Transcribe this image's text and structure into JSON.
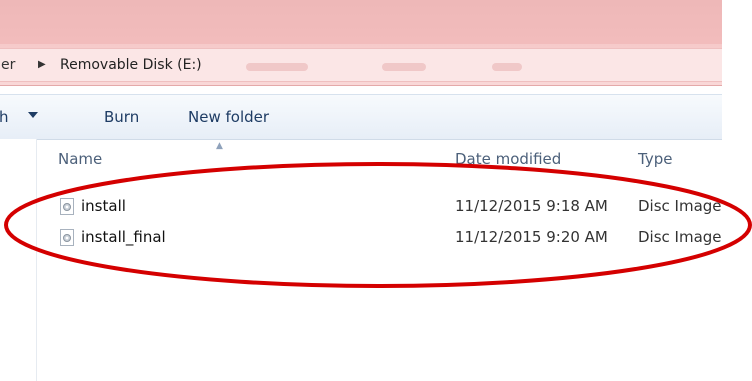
{
  "address": {
    "previous_crumb": "er",
    "current_location": "Removable Disk (E:)"
  },
  "toolbar": {
    "burn_label": "Burn",
    "new_folder_label": "New folder",
    "organize_partial": "h"
  },
  "columns": {
    "name": "Name",
    "date_modified": "Date modified",
    "type": "Type"
  },
  "files": [
    {
      "name": "install",
      "date_modified": "11/12/2015 9:18 AM",
      "type": "Disc Image File",
      "icon": "disc-image-icon"
    },
    {
      "name": "install_final",
      "date_modified": "11/12/2015 9:20 AM",
      "type": "Disc Image File",
      "icon": "disc-image-icon"
    }
  ],
  "colors": {
    "title_bar": "#eeb8b8",
    "annotation": "#d40000",
    "toolbar_text": "#1e3c64"
  }
}
